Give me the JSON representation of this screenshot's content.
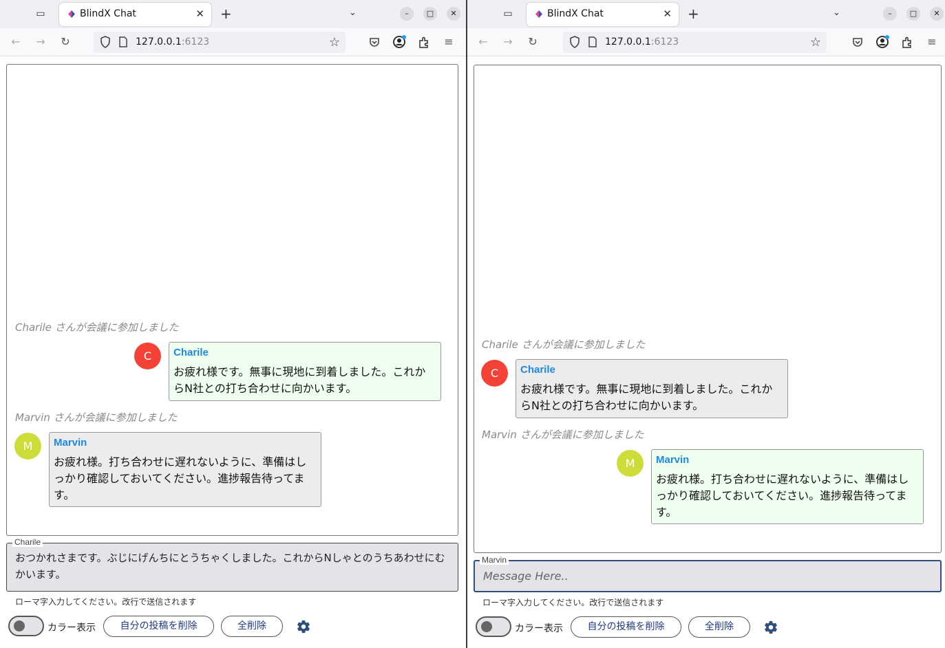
{
  "browser": {
    "tab_title": "BlindX Chat",
    "url_host": "127.0.0.1",
    "url_port": ":6123",
    "minimize_glyph": "–",
    "maximize_glyph": "□",
    "close_glyph": "✕",
    "new_tab_glyph": "+",
    "tab_close_glyph": "✕"
  },
  "left": {
    "join_charile": "Charile さんが会議に参加しました",
    "join_marvin": "Marvin さんが会議に参加しました",
    "msg1": {
      "avatar": "C",
      "name": "Charile",
      "text": "お疲れ様です。無事に現地に到着しました。これからN社との打ち合わせに向かいます。",
      "mine": true
    },
    "msg2": {
      "avatar": "M",
      "name": "Marvin",
      "text": "お疲れ様。打ち合わせに遅れないように、準備はしっかり確認しておいてください。進捗報告待ってます。",
      "mine": false
    },
    "input_label": "Charile",
    "input_value": "おつかれさまです。ぶじにげんちにとうちゃくしました。これからNしゃとのうちあわせにむかいます。",
    "helper": "ローマ字入力してください。改行で送信されます",
    "toggle_label": "カラー表示",
    "delete_mine_label": "自分の投稿を削除",
    "delete_all_label": "全削除"
  },
  "right": {
    "join_charile": "Charile さんが会議に参加しました",
    "join_marvin": "Marvin さんが会議に参加しました",
    "msg1": {
      "avatar": "C",
      "name": "Charile",
      "text": "お疲れ様です。無事に現地に到着しました。これからN社との打ち合わせに向かいます。",
      "mine": false
    },
    "msg2": {
      "avatar": "M",
      "name": "Marvin",
      "text": "お疲れ様。打ち合わせに遅れないように、準備はしっかり確認しておいてください。進捗報告待ってます。",
      "mine": true
    },
    "input_label": "Marvin",
    "input_placeholder": "Message Here..",
    "helper": "ローマ字入力してください。改行で送信されます",
    "toggle_label": "カラー表示",
    "delete_mine_label": "自分の投稿を削除",
    "delete_all_label": "全削除"
  },
  "colors": {
    "avatar_c": "#f44336",
    "avatar_m": "#cddc39",
    "name": "#1e88e5",
    "mine_bubble": "#efffef",
    "other_bubble": "#ececec"
  }
}
